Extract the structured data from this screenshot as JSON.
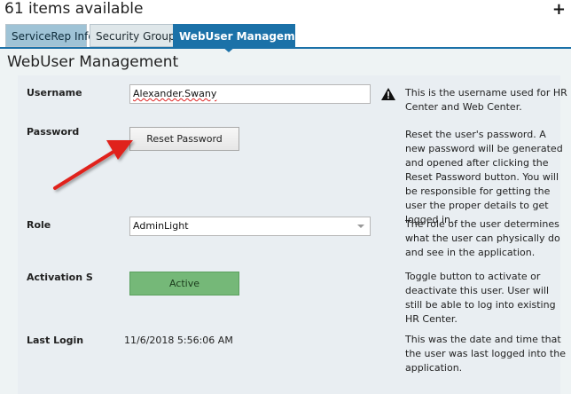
{
  "header": {
    "items_count": "61 items available",
    "add_icon": "plus-icon"
  },
  "tabs": [
    {
      "label": "ServiceRep Info",
      "active": false
    },
    {
      "label": "Security Groups",
      "active": false
    },
    {
      "label": "WebUser Management",
      "active": true
    }
  ],
  "section": {
    "title": "WebUser Management"
  },
  "fields": {
    "username": {
      "label": "Username",
      "value": "Alexander.Swany",
      "help": "This is the username used for HR Center and Web Center.",
      "icon": "warning-icon"
    },
    "password": {
      "label": "Password",
      "button_label": "Reset Password",
      "help": "Reset the user's password. A new password will be generated and opened after clicking the Reset Password button. You will be responsible for getting the user the proper details to get logged in."
    },
    "role": {
      "label": "Role",
      "selected": "AdminLight",
      "help": "The role of the user determines what the user can physically do and see in the application."
    },
    "activation": {
      "label": "Activation S",
      "button_label": "Active",
      "help": "Toggle button to activate or deactivate this user. User will still be able to log into existing HR Center."
    },
    "last_login": {
      "label": "Last Login",
      "value": "11/6/2018 5:56:06 AM",
      "help": "This was the date and time that the user was last logged into the application."
    }
  },
  "colors": {
    "accent": "#1b71a8",
    "active_green": "#75b878",
    "annotation_arrow": "#e0231f"
  }
}
